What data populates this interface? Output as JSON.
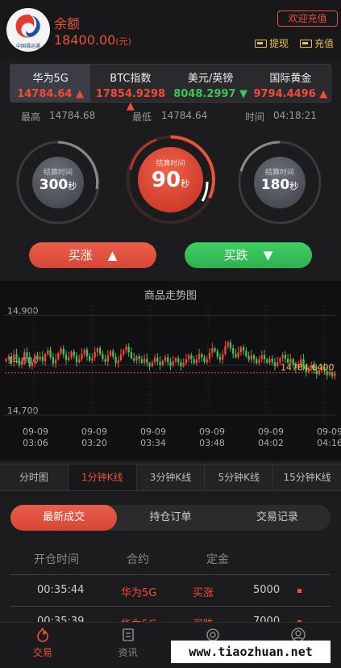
{
  "header": {
    "logo_text": "中国福运通",
    "balance_label": "余额",
    "balance_value": "18400.00",
    "balance_unit": "(元)",
    "welcome_button": "欢迎充值",
    "withdraw_label": "提现",
    "recharge_label": "充值",
    "accent_color": "#e8523a"
  },
  "tickers": [
    {
      "name": "华为5G",
      "value": "14784.64",
      "trend": "up",
      "active": true
    },
    {
      "name": "BTC指数",
      "value": "17854.9298",
      "trend": "up"
    },
    {
      "name": "美元/英镑",
      "value": "8048.2997",
      "trend": "down"
    },
    {
      "name": "国际黄金",
      "value": "9794.4496",
      "trend": "up"
    }
  ],
  "stats": {
    "high_label": "最高",
    "high_value": "14784.68",
    "low_label": "最低",
    "low_value": "14784.64",
    "time_label": "时间",
    "time_value": "04:18:21"
  },
  "dials": [
    {
      "label": "结算时间",
      "value": "300",
      "unit": "秒",
      "selected": false
    },
    {
      "label": "结算时间",
      "value": "90",
      "unit": "秒",
      "selected": true
    },
    {
      "label": "结算时间",
      "value": "180",
      "unit": "秒",
      "selected": false
    }
  ],
  "actions": {
    "buy_up": "买涨",
    "buy_up_icon": "▲",
    "buy_down": "买跌",
    "buy_down_icon": "▼"
  },
  "chart_data": {
    "type": "candlestick",
    "title": "商品走势图",
    "ylim": [
      14690,
      14920
    ],
    "y_ticks": [
      "14,900",
      "14,800",
      "14,700"
    ],
    "x_ticks": [
      [
        "09-09",
        "03:06"
      ],
      [
        "09-09",
        "03:20"
      ],
      [
        "09-09",
        "03:34"
      ],
      [
        "09-09",
        "03:48"
      ],
      [
        "09-09",
        "04:02"
      ],
      [
        "09-09",
        "04:16"
      ]
    ],
    "current_price_label": "14784.6400",
    "current_price": 14784.64,
    "up_color": "#f04a38",
    "down_color": "#3cc35a",
    "closes": [
      14812,
      14818,
      14806,
      14822,
      14814,
      14800,
      14809,
      14826,
      14815,
      14798,
      14805,
      14820,
      14811,
      14817,
      14808,
      14822,
      14830,
      14816,
      14803,
      14812,
      14824,
      14833,
      14821,
      14810,
      14816,
      14827,
      14819,
      14806,
      14812,
      14823,
      14831,
      14818,
      14809,
      14815,
      14826,
      14834,
      14822,
      14812,
      14807,
      14819,
      14828,
      14817,
      14804,
      14810,
      14822,
      14830,
      14837,
      14826,
      14814,
      14809,
      14818,
      14812,
      14805,
      14813,
      14804,
      14798,
      14806,
      14815,
      14807,
      14800,
      14809,
      14816,
      14806,
      14799,
      14808,
      14814,
      14806,
      14798,
      14805,
      14812,
      14820,
      14812,
      14804,
      14812,
      14822,
      14816,
      14806,
      14812,
      14825,
      14834,
      14828,
      14817,
      14811,
      14822,
      14838,
      14846,
      14834,
      14823,
      14816,
      14826,
      14836,
      14829,
      14818,
      14811,
      14820,
      14812,
      14804,
      14812,
      14820,
      14812,
      14805,
      14813,
      14806,
      14798,
      14806,
      14814,
      14821,
      14813,
      14805,
      14812,
      14802,
      14794,
      14802,
      14812,
      14796,
      14786,
      14794,
      14800,
      14790,
      14782,
      14790,
      14797,
      14788,
      14780,
      14786,
      14778,
      14784
    ]
  },
  "period_tabs": [
    {
      "label": "分时图"
    },
    {
      "label": "1分钟K线",
      "active": true
    },
    {
      "label": "3分钟K线"
    },
    {
      "label": "5分钟K线"
    },
    {
      "label": "15分钟K线"
    }
  ],
  "order_tabs": [
    {
      "label": "最新成交",
      "active": true
    },
    {
      "label": "持仓订单"
    },
    {
      "label": "交易记录"
    }
  ],
  "table": {
    "headers": [
      "开仓时间",
      "合约",
      "定金"
    ],
    "rows": [
      {
        "time": "00:35:44",
        "contract": "华为5G",
        "direction": "买涨",
        "amount": "5000"
      },
      {
        "time": "00:35:39",
        "contract": "华为5G",
        "direction": "买跌",
        "amount": "7000"
      }
    ]
  },
  "nav": [
    {
      "label": "交易",
      "icon": "trade-icon",
      "active": true
    },
    {
      "label": "资讯",
      "icon": "news-icon"
    },
    {
      "label": "",
      "icon": "gift-icon"
    },
    {
      "label": "",
      "icon": "user-icon"
    }
  ],
  "watermark": "www.tiaozhuan.net"
}
